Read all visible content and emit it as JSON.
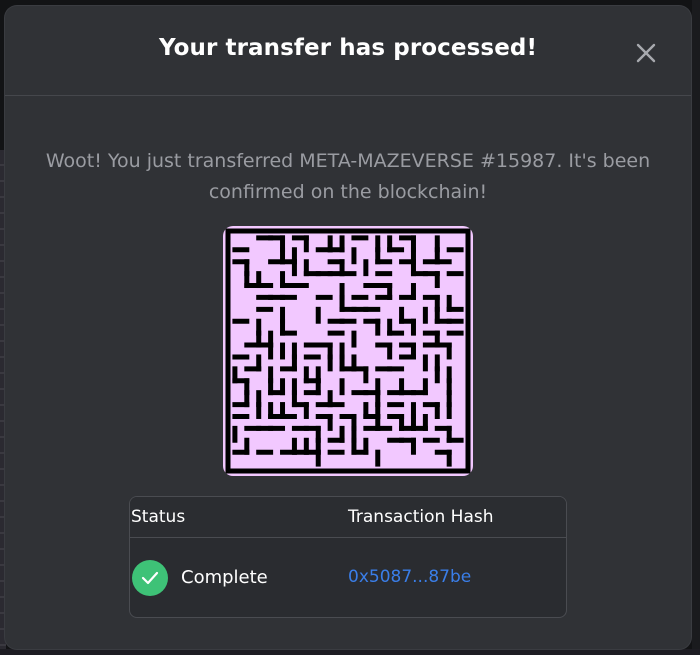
{
  "modal": {
    "title": "Your transfer has processed!",
    "close_icon": "close-icon",
    "message": "Woot! You just transferred META-MAZEVERSE #15987. It's been confirmed on the blockchain!"
  },
  "nft": {
    "name": "META-MAZEVERSE #15987",
    "maze_color": "#f2c8ff",
    "wall_color": "#000000"
  },
  "table": {
    "headers": {
      "status": "Status",
      "hash": "Transaction Hash"
    },
    "row": {
      "status_icon": "check-circle-icon",
      "status": "Complete",
      "hash": "0x5087...87be"
    }
  },
  "colors": {
    "modal_bg": "#303236",
    "success": "#3ec277",
    "link": "#3a7ee8"
  }
}
